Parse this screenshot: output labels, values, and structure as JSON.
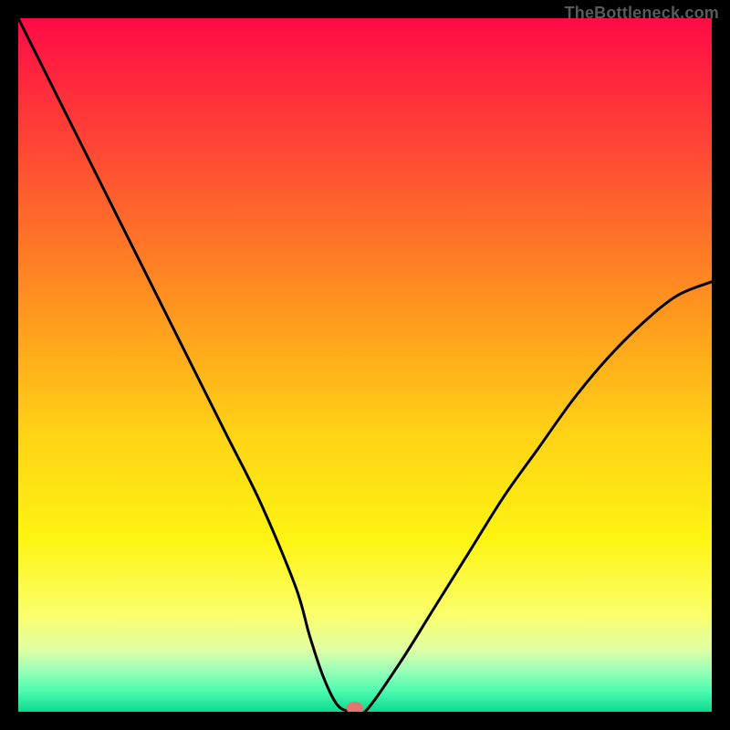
{
  "attribution": "TheBottleneck.com",
  "chart_data": {
    "type": "line",
    "title": "",
    "xlabel": "",
    "ylabel": "",
    "xlim": [
      0,
      100
    ],
    "ylim": [
      0,
      100
    ],
    "grid": false,
    "legend": false,
    "gradient_stops": [
      {
        "offset": 0.0,
        "color": "#ff0b46"
      },
      {
        "offset": 0.2,
        "color": "#ff4b33"
      },
      {
        "offset": 0.4,
        "color": "#ff8f20"
      },
      {
        "offset": 0.6,
        "color": "#ffd316"
      },
      {
        "offset": 0.75,
        "color": "#fef412"
      },
      {
        "offset": 0.86,
        "color": "#fbff6b"
      },
      {
        "offset": 0.91,
        "color": "#e0ffa4"
      },
      {
        "offset": 0.94,
        "color": "#9bffb8"
      },
      {
        "offset": 0.97,
        "color": "#4efcb0"
      },
      {
        "offset": 1.0,
        "color": "#0bd98f"
      }
    ],
    "series": [
      {
        "name": "bottleneck-curve",
        "x": [
          0,
          5,
          10,
          15,
          20,
          25,
          30,
          35,
          40,
          42,
          44,
          46,
          48,
          50,
          55,
          60,
          65,
          70,
          75,
          80,
          85,
          90,
          95,
          100
        ],
        "values": [
          100,
          90,
          80,
          70,
          60,
          50,
          40,
          30,
          18,
          11,
          5,
          1,
          0,
          0,
          7,
          15,
          23,
          31,
          38,
          45,
          51,
          56,
          60,
          62
        ]
      }
    ],
    "marker": {
      "x": 48.5,
      "y": 0,
      "color": "#e4766f"
    }
  }
}
